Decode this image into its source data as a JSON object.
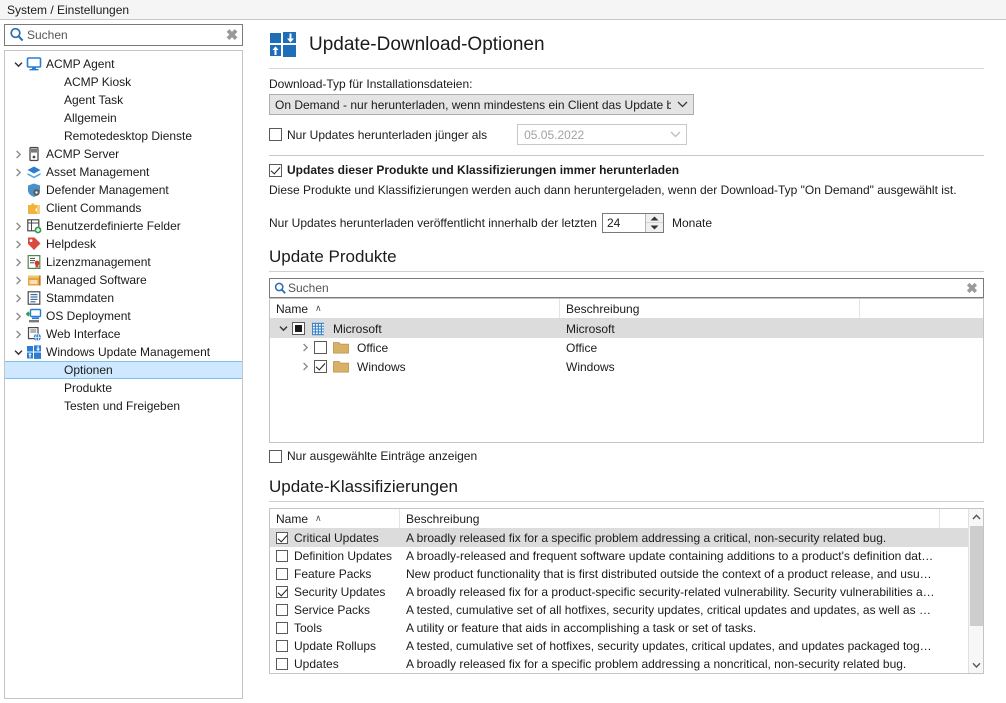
{
  "titlebar": {
    "breadcrumb": "System / Einstellungen"
  },
  "sidebar": {
    "search": {
      "placeholder": "Suchen",
      "clear": "✖",
      "icon": "search-icon"
    },
    "items": [
      {
        "label": "ACMP Agent",
        "depth": 0,
        "expander": "down",
        "icon": "monitor-icon",
        "selected": false
      },
      {
        "label": "ACMP Kiosk",
        "depth": 1,
        "expander": "none",
        "icon": "none",
        "selected": false
      },
      {
        "label": "Agent Task",
        "depth": 1,
        "expander": "none",
        "icon": "none",
        "selected": false
      },
      {
        "label": "Allgemein",
        "depth": 1,
        "expander": "none",
        "icon": "none",
        "selected": false
      },
      {
        "label": "Remotedesktop Dienste",
        "depth": 1,
        "expander": "none",
        "icon": "none",
        "selected": false
      },
      {
        "label": "ACMP Server",
        "depth": 0,
        "expander": "right",
        "icon": "server-icon",
        "selected": false
      },
      {
        "label": "Asset Management",
        "depth": 0,
        "expander": "right",
        "icon": "box-icon",
        "selected": false
      },
      {
        "label": "Defender Management",
        "depth": 0,
        "expander": "none",
        "icon": "shield-icon",
        "selected": false
      },
      {
        "label": "Client Commands",
        "depth": 0,
        "expander": "none",
        "icon": "puzzle-icon",
        "selected": false
      },
      {
        "label": "Benutzerdefinierte Felder",
        "depth": 0,
        "expander": "right",
        "icon": "table-plus-icon",
        "selected": false
      },
      {
        "label": "Helpdesk",
        "depth": 0,
        "expander": "right",
        "icon": "tag-icon",
        "selected": false
      },
      {
        "label": "Lizenzmanagement",
        "depth": 0,
        "expander": "right",
        "icon": "certificate-icon",
        "selected": false
      },
      {
        "label": "Managed Software",
        "depth": 0,
        "expander": "right",
        "icon": "package-icon",
        "selected": false
      },
      {
        "label": "Stammdaten",
        "depth": 0,
        "expander": "right",
        "icon": "list-icon",
        "selected": false
      },
      {
        "label": "OS Deployment",
        "depth": 0,
        "expander": "right",
        "icon": "deploy-icon",
        "selected": false
      },
      {
        "label": "Web Interface",
        "depth": 0,
        "expander": "right",
        "icon": "web-icon",
        "selected": false
      },
      {
        "label": "Windows Update Management",
        "depth": 0,
        "expander": "down",
        "icon": "windows-icon",
        "selected": false
      },
      {
        "label": "Optionen",
        "depth": 1,
        "expander": "none",
        "icon": "none",
        "selected": true
      },
      {
        "label": "Produkte",
        "depth": 1,
        "expander": "none",
        "icon": "none",
        "selected": false
      },
      {
        "label": "Testen und Freigeben",
        "depth": 1,
        "expander": "none",
        "icon": "none",
        "selected": false
      }
    ]
  },
  "page": {
    "title": "Update-Download-Optionen",
    "title_icon": "windows-update-icon",
    "download_type_label": "Download-Typ für Installationsdateien:",
    "download_type_value": "On Demand - nur herunterladen, wenn mindestens ein Client das Update benötigt",
    "only_newer": {
      "label": "Nur Updates herunterladen jünger als",
      "checked": false,
      "date_value": "05.05.2022"
    },
    "always_download": {
      "label": "Updates dieser Produkte und Klassifizierungen immer herunterladen",
      "checked": true,
      "description": "Diese Produkte und Klassifizierungen werden auch dann heruntergeladen, wenn der Download-Typ \"On Demand\" ausgewählt ist."
    },
    "months_filter": {
      "prefix": "Nur Updates herunterladen veröffentlicht innerhalb der letzten",
      "value": "24",
      "suffix": "Monate"
    },
    "products": {
      "heading": "Update Produkte",
      "search_placeholder": "Suchen",
      "search_clear": "✖",
      "columns": [
        "Name",
        "Beschreibung"
      ],
      "sort_caret": "∧",
      "rows": [
        {
          "name": "Microsoft",
          "description": "Microsoft",
          "check": "indeterminate",
          "depth": 0,
          "expander": "down",
          "icon": "building-icon",
          "selected": true
        },
        {
          "name": "Office",
          "description": "Office",
          "check": "unchecked",
          "depth": 1,
          "expander": "right",
          "icon": "folder-icon",
          "selected": false
        },
        {
          "name": "Windows",
          "description": "Windows",
          "check": "checked",
          "depth": 1,
          "expander": "right",
          "icon": "folder-icon",
          "selected": false
        }
      ],
      "only_selected": {
        "label": "Nur ausgewählte Einträge anzeigen",
        "checked": false
      }
    },
    "classifications": {
      "heading": "Update-Klassifizierungen",
      "columns": [
        "Name",
        "Beschreibung"
      ],
      "sort_caret": "∧",
      "rows": [
        {
          "name": "Critical Updates",
          "description": "A broadly released fix for a specific problem addressing a critical, non-security related bug.",
          "checked": true,
          "selected": true
        },
        {
          "name": "Definition Updates",
          "description": "A broadly-released and frequent software update containing additions to a product's definition dat…",
          "checked": false,
          "selected": false
        },
        {
          "name": "Feature Packs",
          "description": "New product functionality that is first distributed outside the context of a product release, and usu…",
          "checked": false,
          "selected": false
        },
        {
          "name": "Security Updates",
          "description": "A broadly released fix for a product-specific security-related vulnerability. Security vulnerabilities a…",
          "checked": true,
          "selected": false
        },
        {
          "name": "Service Packs",
          "description": "A tested, cumulative set of all hotfixes, security updates, critical updates and updates, as well as …",
          "checked": false,
          "selected": false
        },
        {
          "name": "Tools",
          "description": "A utility or feature that aids in accomplishing a task or set of tasks.",
          "checked": false,
          "selected": false
        },
        {
          "name": "Update Rollups",
          "description": "A tested, cumulative set of hotfixes, security updates, critical updates, and updates packaged tog…",
          "checked": false,
          "selected": false
        },
        {
          "name": "Updates",
          "description": "A broadly released fix for a specific problem addressing a noncritical, non-security related bug.",
          "checked": false,
          "selected": false
        }
      ],
      "scrollbar": {
        "up": "∧",
        "down": "∨"
      }
    }
  },
  "colors": {
    "selection_blue": "#cde8ff",
    "selection_border": "#7cc0f0",
    "row_selected_gray": "#dcdcdc",
    "accent_blue": "#2b7cd3",
    "folder_gold": "#d9b166"
  }
}
